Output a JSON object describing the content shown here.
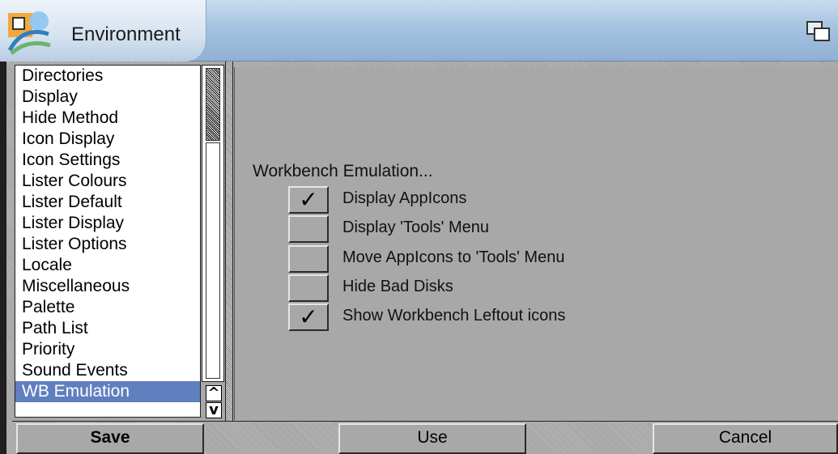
{
  "window": {
    "title": "Environment"
  },
  "list": {
    "items": [
      "Directories",
      "Display",
      "Hide Method",
      "Icon Display",
      "Icon Settings",
      "Lister Colours",
      "Lister Default",
      "Lister Display",
      "Lister Options",
      "Locale",
      "Miscellaneous",
      "Palette",
      "Path List",
      "Priority",
      "Sound Events",
      "WB Emulation"
    ],
    "selected": "WB Emulation",
    "scroll_up_glyph": "^",
    "scroll_down_glyph": "v"
  },
  "panel": {
    "heading": "Workbench Emulation...",
    "options": [
      {
        "label": "Display AppIcons",
        "checked": true
      },
      {
        "label": "Display 'Tools' Menu",
        "checked": false
      },
      {
        "label": "Move AppIcons to 'Tools' Menu",
        "checked": false
      },
      {
        "label": "Hide Bad Disks",
        "checked": false
      },
      {
        "label": "Show Workbench Leftout icons",
        "checked": true
      }
    ],
    "check_glyph": "✓"
  },
  "buttons": {
    "save": "Save",
    "use": "Use",
    "cancel": "Cancel"
  },
  "colors": {
    "selection": "#5f7fbf",
    "panel_gray": "#a8a8a8"
  }
}
